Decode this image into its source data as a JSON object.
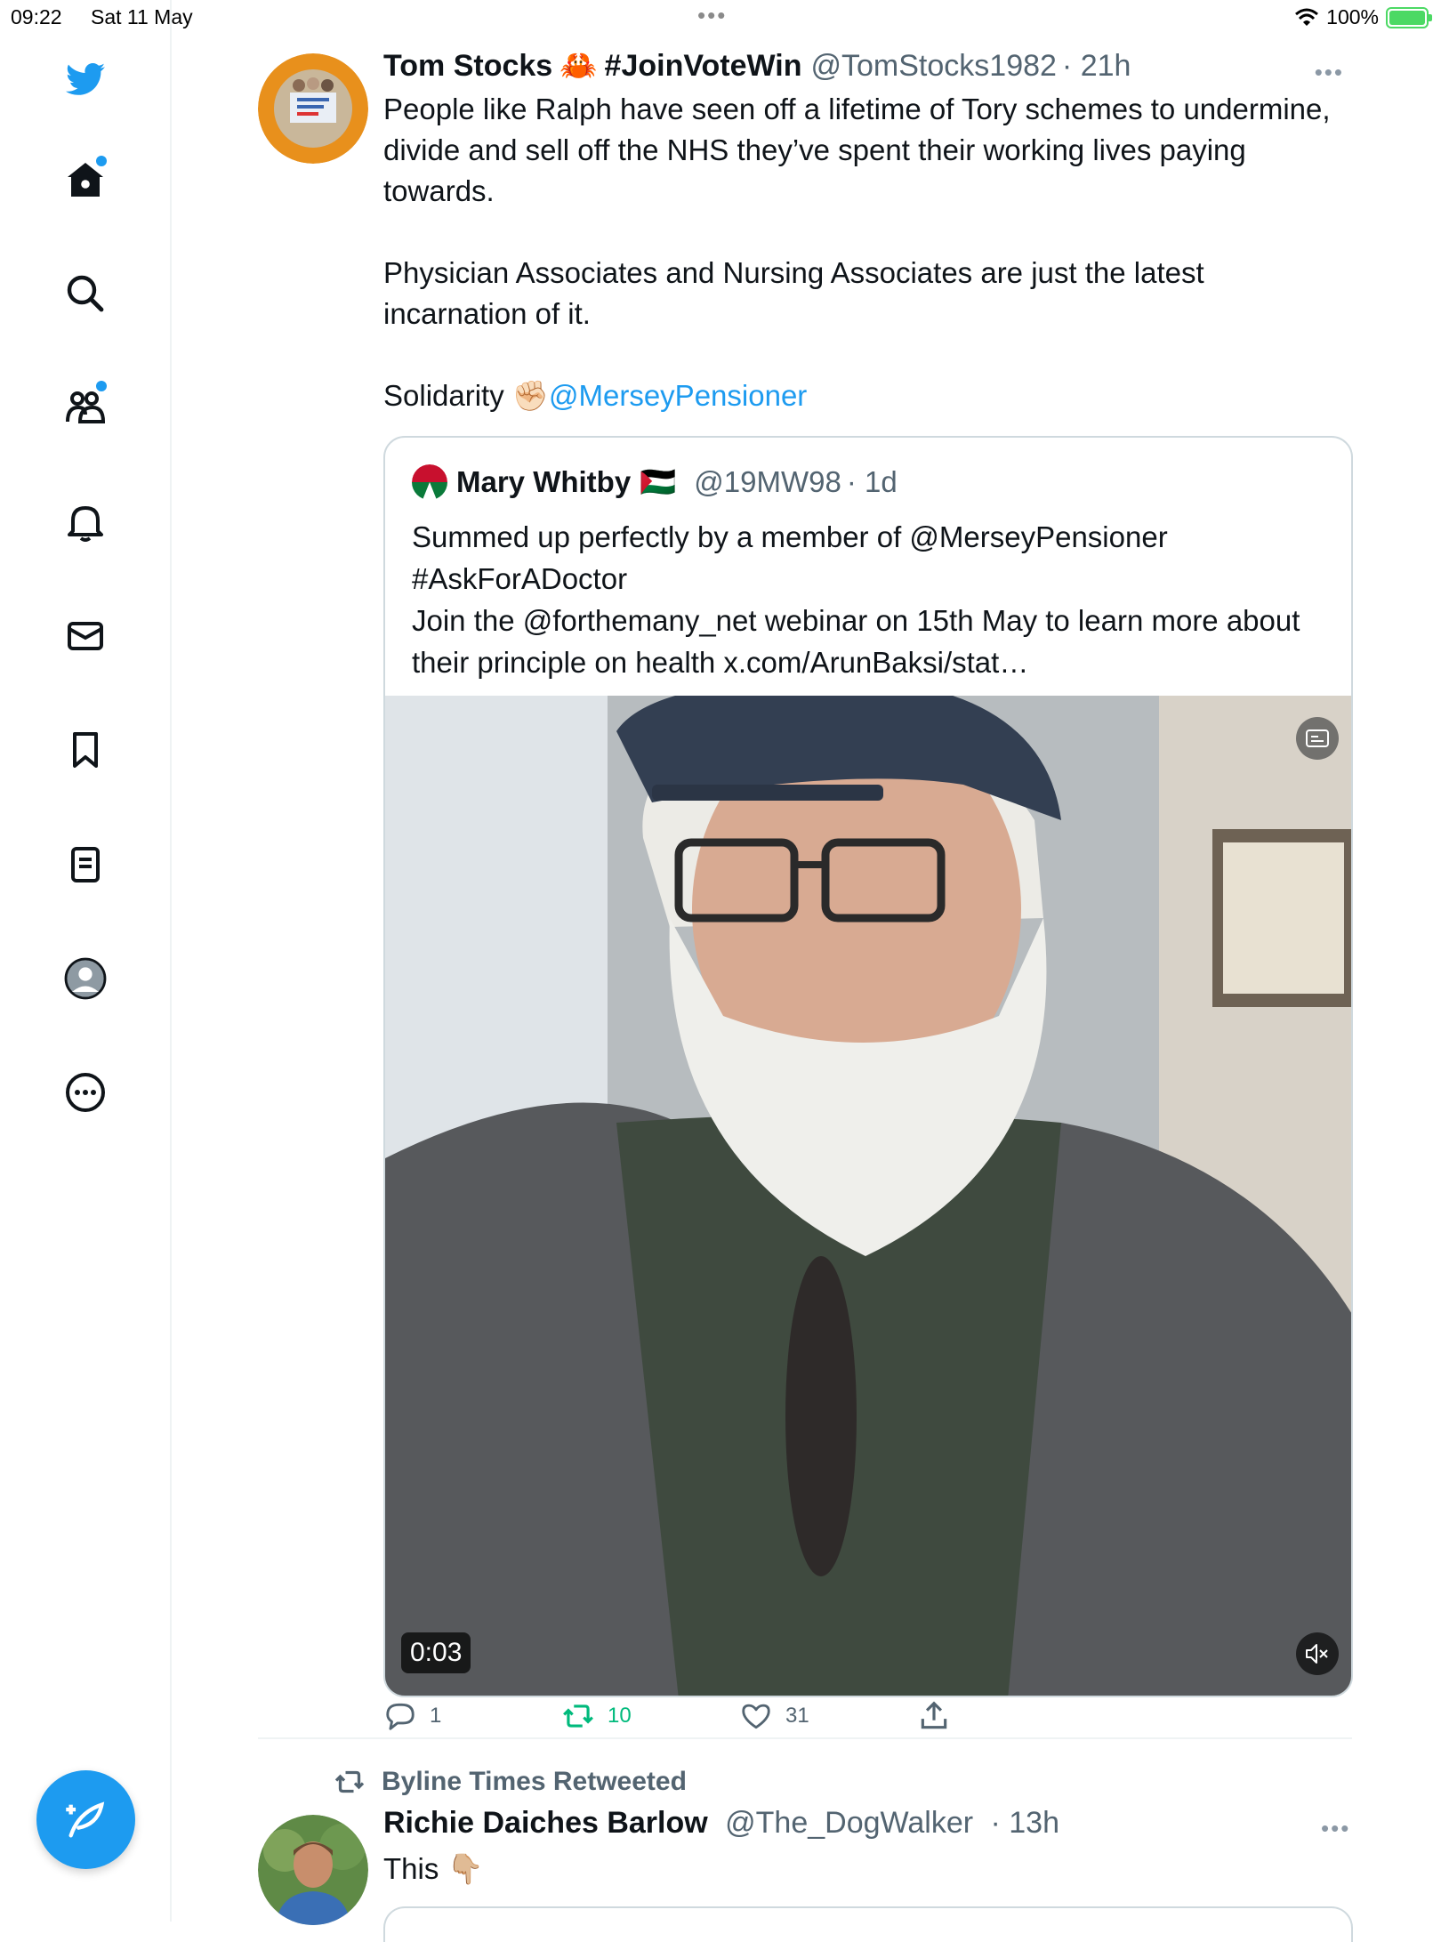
{
  "status": {
    "time": "09:22",
    "date": "Sat 11 May",
    "dots": "•••",
    "battery": "100%",
    "battery_fraction": 1.0
  },
  "sidebar": {
    "items": [
      {
        "icon": "bird-logo-icon"
      },
      {
        "icon": "home-icon",
        "dot": true
      },
      {
        "icon": "search-icon"
      },
      {
        "icon": "communities-icon",
        "dot": true
      },
      {
        "icon": "bell-icon"
      },
      {
        "icon": "mail-icon"
      },
      {
        "icon": "bookmark-icon"
      },
      {
        "icon": "list-icon"
      },
      {
        "icon": "profile-avatar-icon"
      },
      {
        "icon": "more-circle-icon"
      }
    ],
    "accent": "#1d9bf0"
  },
  "tweet": {
    "name": "Tom Stocks",
    "name_emoji": "🦀",
    "name_suffix": "#JoinVoteWin",
    "handle": "@TomStocks1982",
    "time": "· 21h",
    "more": "•••",
    "paragraphs": [
      "People like Ralph have seen off a lifetime of Tory schemes to undermine, divide and sell off the NHS they’ve spent their working lives paying towards.",
      "Physician Associates and Nursing Associates are just the latest incarnation of it."
    ],
    "solidarity_text": "Solidarity",
    "solidarity_emoji": "✊🏻",
    "solidarity_mention": "@MerseyPensioner",
    "avatar_text_top": "#BMABallotReady",
    "avatar_text_bottom": "Vote Yes for strike action",
    "quote": {
      "name": "Mary Whitby",
      "flag": "🇵🇸",
      "handle": "@19MW98",
      "time": "· 1d",
      "lines": [
        "Summed up perfectly by a member of @MerseyPensioner",
        "#AskForADoctor",
        "Join the @forthemany_net webinar on 15th May to learn more about their principle on health x.com/ArunBaksi/stat…"
      ],
      "video_time": "0:03"
    },
    "actions": {
      "reply": "1",
      "retweet": "10",
      "like": "31"
    }
  },
  "tweet2": {
    "retweeted_by": "Byline Times Retweeted",
    "name": "Richie Daiches Barlow",
    "handle": "@The_DogWalker",
    "time": "· 13h",
    "more": "•••",
    "text": "This",
    "text_emoji": "👇🏼"
  }
}
